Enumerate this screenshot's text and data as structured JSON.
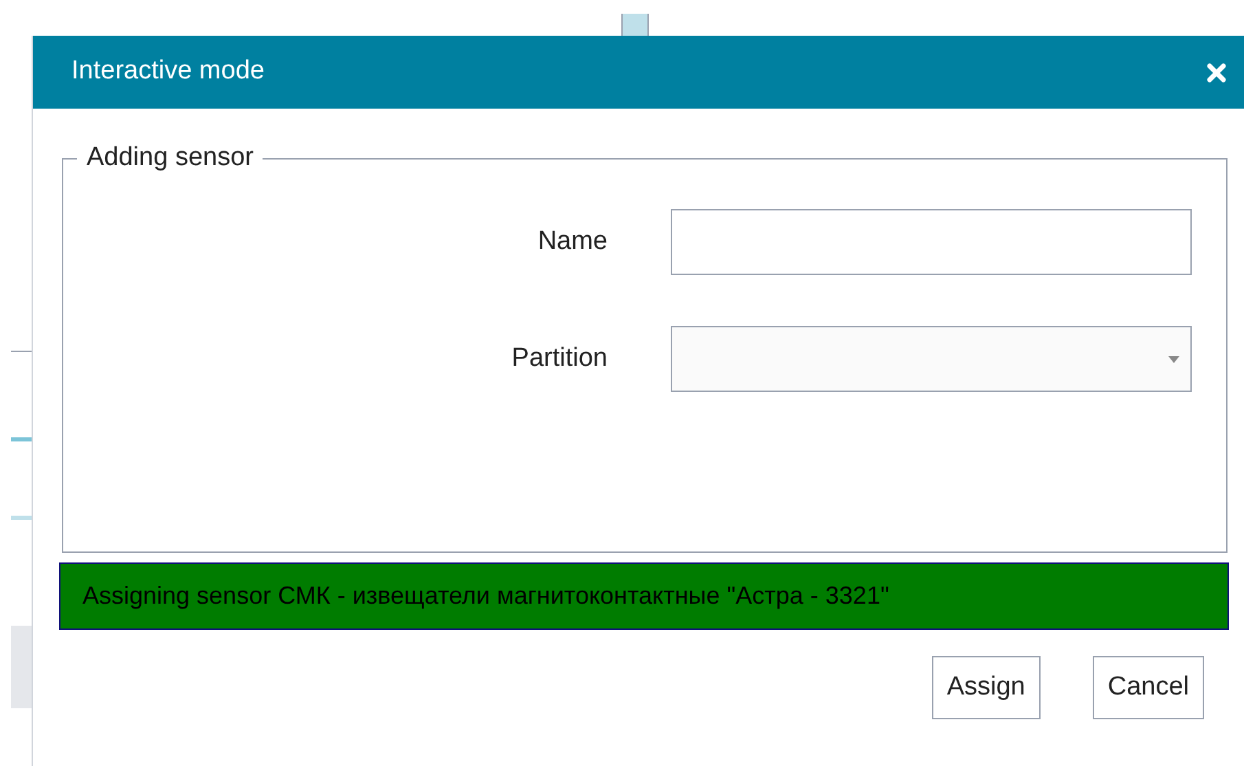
{
  "dialog": {
    "title": "Interactive mode"
  },
  "group": {
    "legend": "Adding sensor"
  },
  "fields": [
    {
      "label": "Name",
      "kind": "text"
    },
    {
      "label": "Partition",
      "kind": "select"
    }
  ],
  "message": "Assigning sensor СМК - извещатели магнитоконтактные \"Астра - 3321\"",
  "buttons": [
    "Assign",
    "Cancel"
  ]
}
